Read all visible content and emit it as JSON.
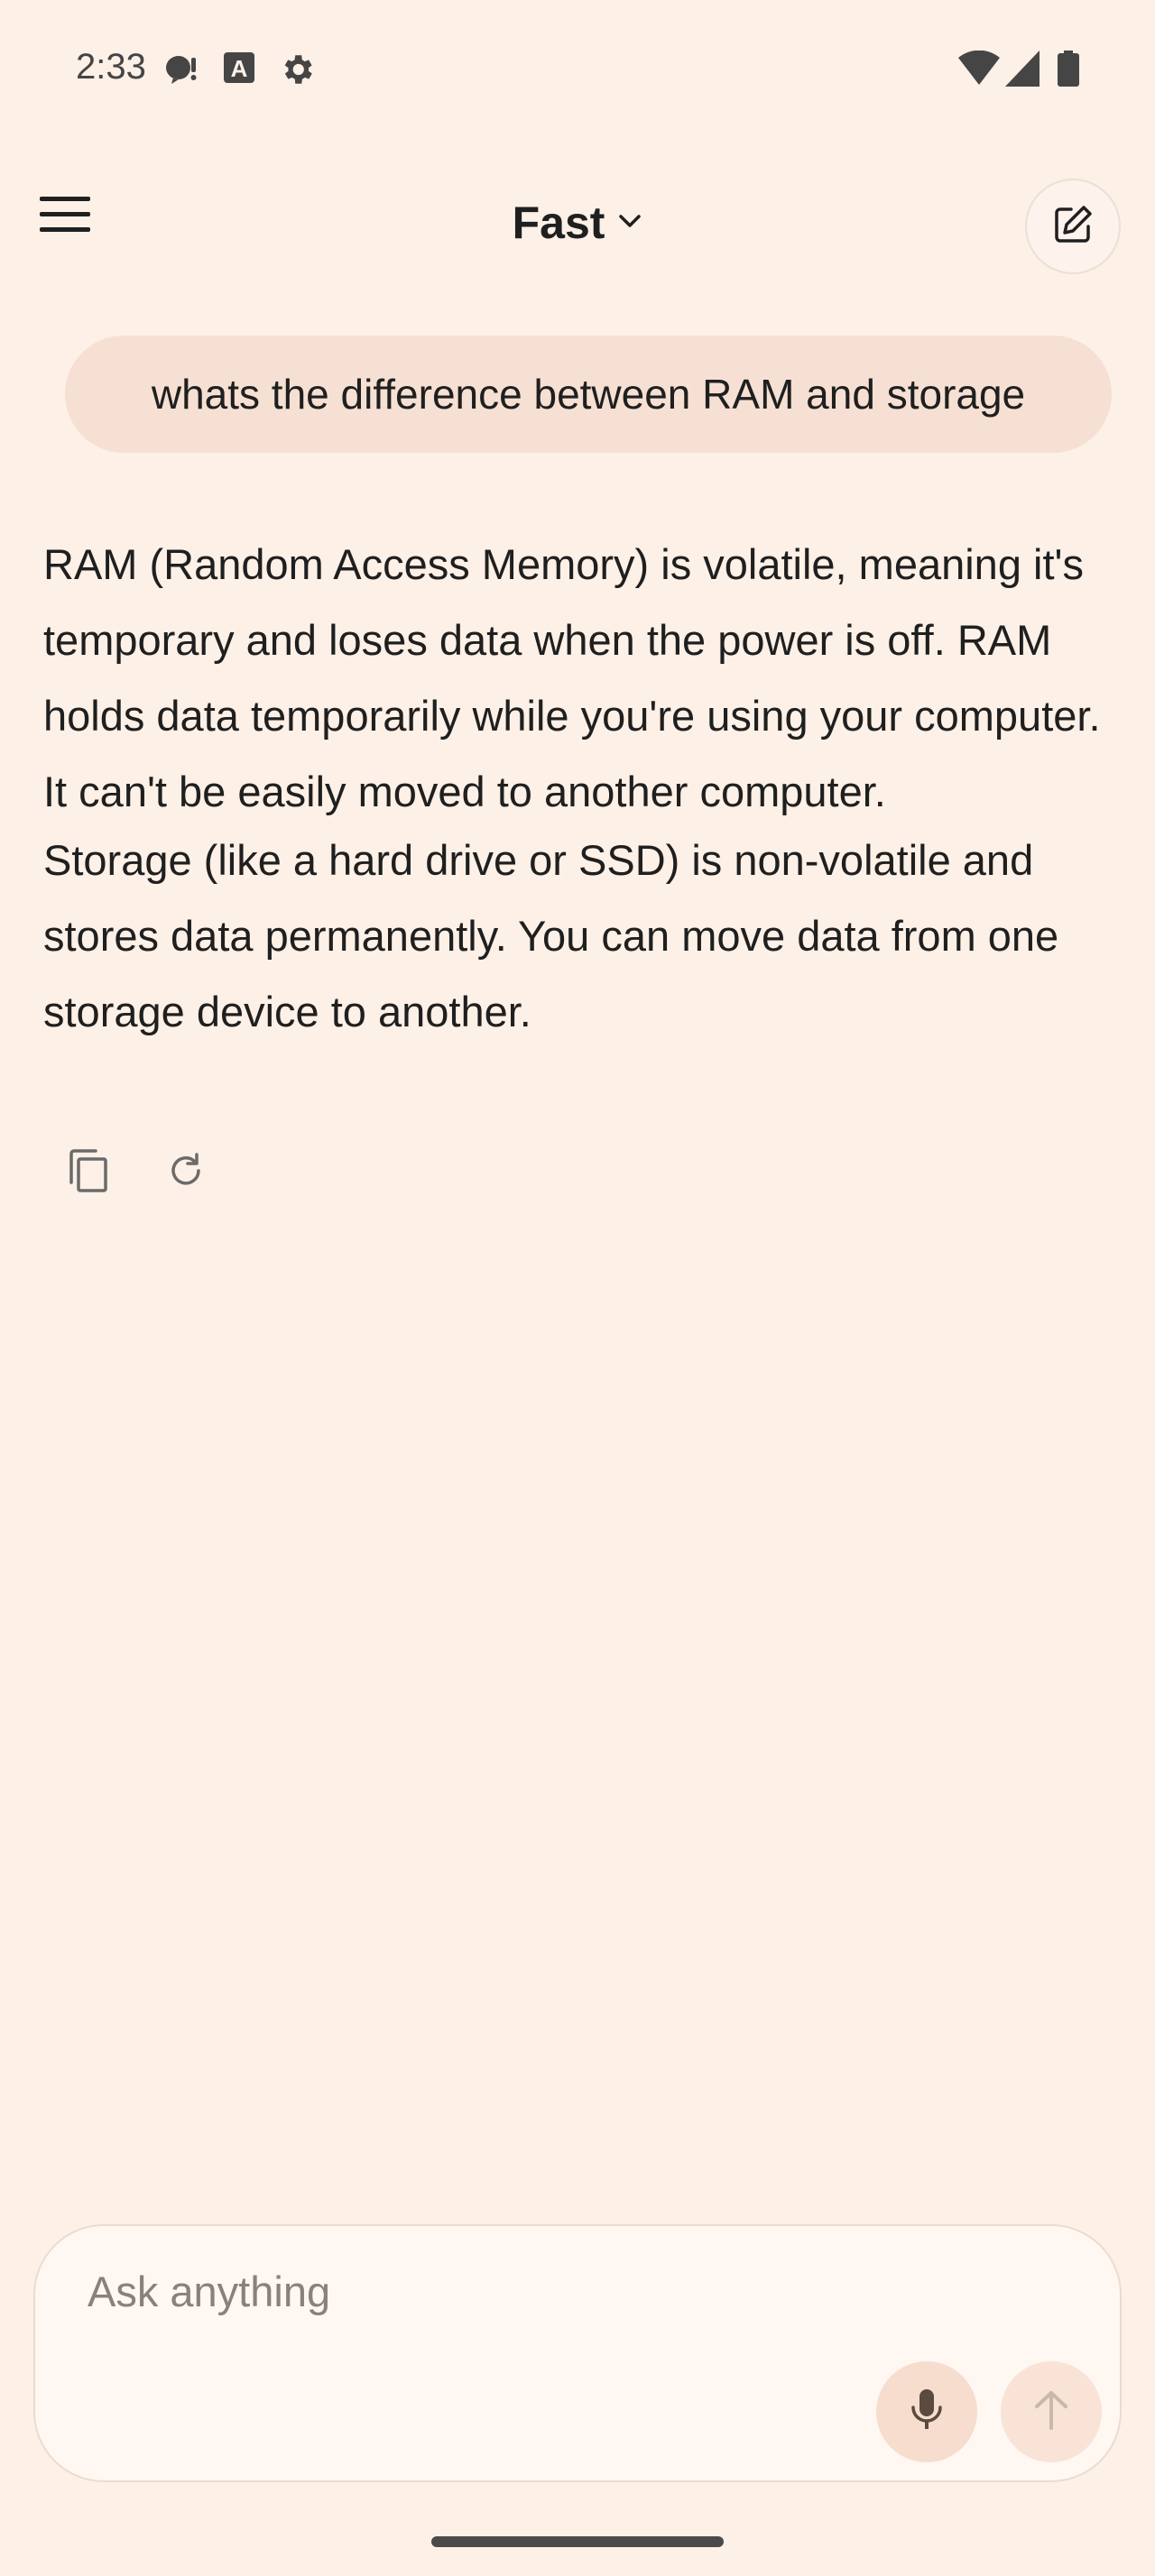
{
  "status_bar": {
    "time": "2:33",
    "icons_left": [
      "chat-bubble-icon",
      "font-a-icon",
      "settings-gear-icon"
    ],
    "icons_right": [
      "wifi-icon",
      "cell-signal-icon",
      "battery-icon"
    ]
  },
  "header": {
    "model_name": "Fast",
    "menu_icon": "hamburger-menu-icon",
    "new_chat_icon": "edit-pencil-icon"
  },
  "conversation": {
    "user_message": "whats the difference between RAM and storage",
    "assistant_paragraphs": [
      "RAM (Random Access Memory) is volatile, meaning it's temporary and loses data when the power is off. RAM holds data temporarily while you're using your computer. It can't be easily moved to another computer.",
      "Storage (like a hard drive or SSD) is non-volatile and stores data permanently. You can move data from one storage device to another."
    ],
    "actions": [
      "copy-icon",
      "regenerate-icon"
    ]
  },
  "composer": {
    "placeholder": "Ask anything",
    "value": "",
    "mic_icon": "microphone-icon",
    "send_icon": "arrow-up-icon"
  },
  "colors": {
    "background": "#fdf0e7",
    "user_bubble": "#f6e0d3",
    "composer_bg": "#fef7f2",
    "button_bg": "#f6ddcd"
  }
}
